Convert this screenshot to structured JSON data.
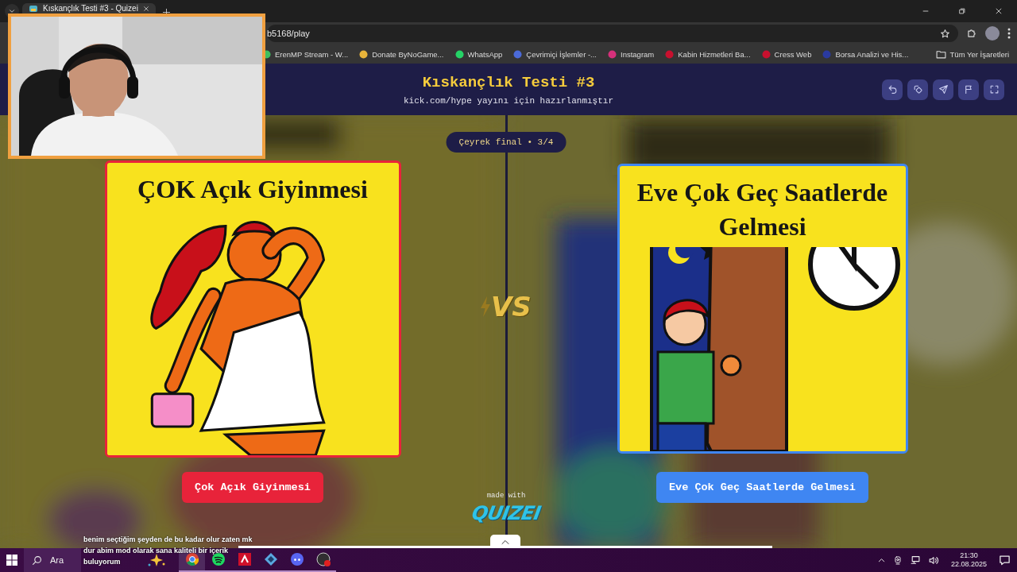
{
  "browser": {
    "tabs": [
      {
        "title": "Kıskançlık Testi #3 - Quizei",
        "selected": true
      }
    ],
    "address": "b5168/play",
    "bookmarks": [
      "ErenMP Stream - W...",
      "Donate ByNoGame...",
      "WhatsApp",
      "Çevrimiçi İşlemler -...",
      "Instagram",
      "Kabin Hizmetleri Ba...",
      "Cress Web",
      "Borsa Analizi ve His..."
    ],
    "all_bookmarks": "Tüm Yer İşaretleri"
  },
  "quiz": {
    "title": "Kıskançlık Testi #3",
    "subtitle": "kick.com/hype yayını için hazırlanmıştır",
    "round": "Çeyrek final • 3/4",
    "versus": "VS",
    "options": [
      {
        "card_title": "ÇOK Açık Giyinmesi",
        "button": "Çok Açık Giyinmesi",
        "color": "#e8233a"
      },
      {
        "card_title": "Eve Çok Geç Saatlerde Gelmesi",
        "button": "Eve Çok Geç Saatlerde Gelmesi",
        "color": "#3f86f2"
      }
    ],
    "made_with": "made with",
    "logo": "QUIZEI"
  },
  "chat": [
    {
      "message": "benim seçtiğim şeyden de bu kadar olur zaten mk"
    },
    {
      "message": "dur abim mod olarak sana kaliteli bir içerik"
    },
    {
      "message": "buluyorum"
    }
  ],
  "taskbar": {
    "search": "Ara",
    "time": "21:30",
    "date": "22.08.2025"
  }
}
